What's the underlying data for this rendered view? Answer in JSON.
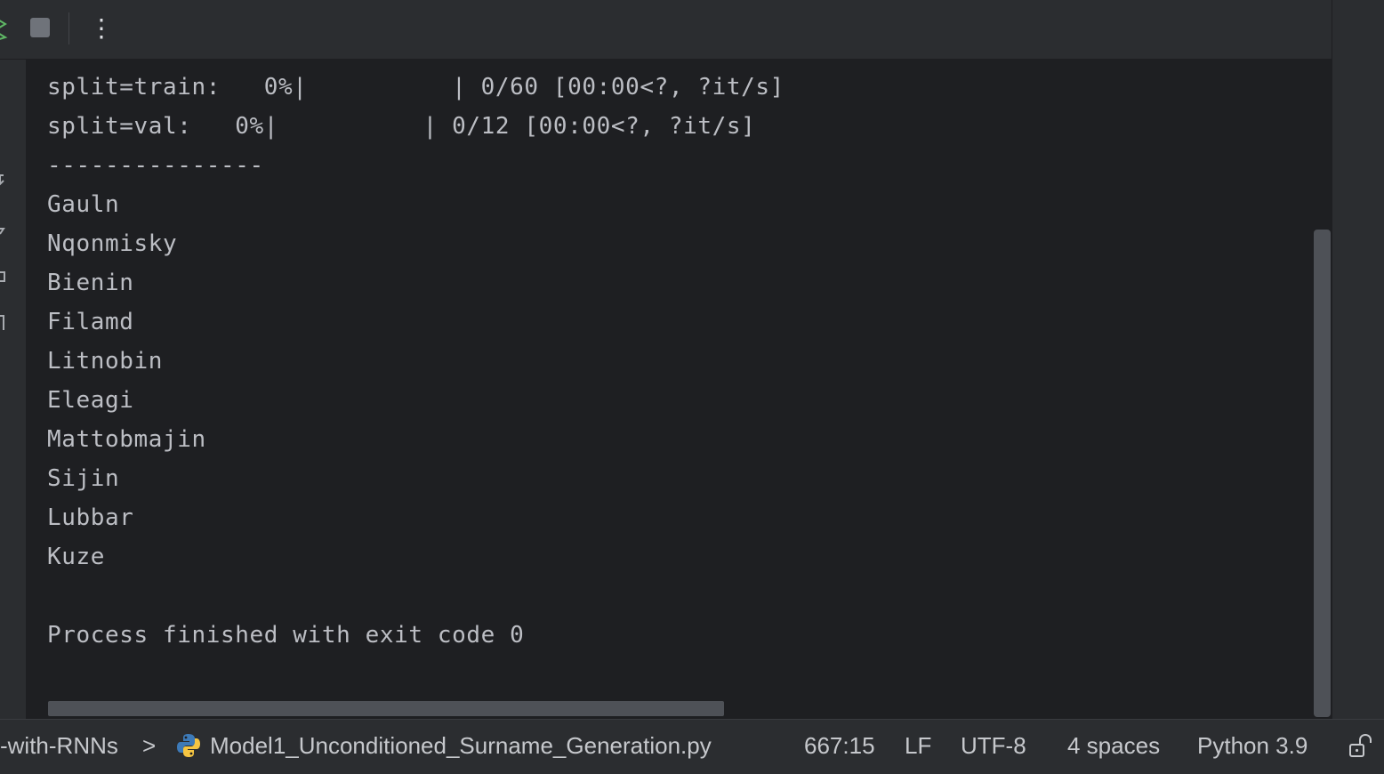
{
  "toolbar": {
    "icons": [
      "rerun-icon",
      "stop-icon",
      "more-vert-icon"
    ],
    "more_glyph": "⋮"
  },
  "gutter": {
    "icons": [
      "scroll-to-end-icon",
      "soft-wrap-icon",
      "print-icon",
      "clear-all-icon"
    ]
  },
  "console": {
    "partial_top_line": "    -",
    "lines": [
      "split=train:   0%|          | 0/60 [00:00<?, ?it/s]",
      "split=val:   0%|          | 0/12 [00:00<?, ?it/s]",
      "---------------",
      "Gauln",
      "Nqonmisky",
      "Bienin",
      "Filamd",
      "Litnobin",
      "Eleagi",
      "Mattobmajin",
      "Sijin",
      "Lubbar",
      "Kuze",
      "",
      "Process finished with exit code 0"
    ]
  },
  "statusbar": {
    "breadcrumb_project": "-with-RNNs",
    "breadcrumb_separator": ">",
    "breadcrumb_file": "Model1_Unconditioned_Surname_Generation.py",
    "caret_position": "667:15",
    "line_separator": "LF",
    "encoding": "UTF-8",
    "indent": "4 spaces",
    "interpreter": "Python 3.9",
    "file_icon": "python-file-icon",
    "lock_icon": "unlock-icon"
  },
  "colors": {
    "background": "#1e1f22",
    "panel": "#2b2d30",
    "text": "#bcbec4",
    "run_green": "#5fb865",
    "python_blue": "#3d7ab8",
    "python_yellow": "#f5c542"
  }
}
